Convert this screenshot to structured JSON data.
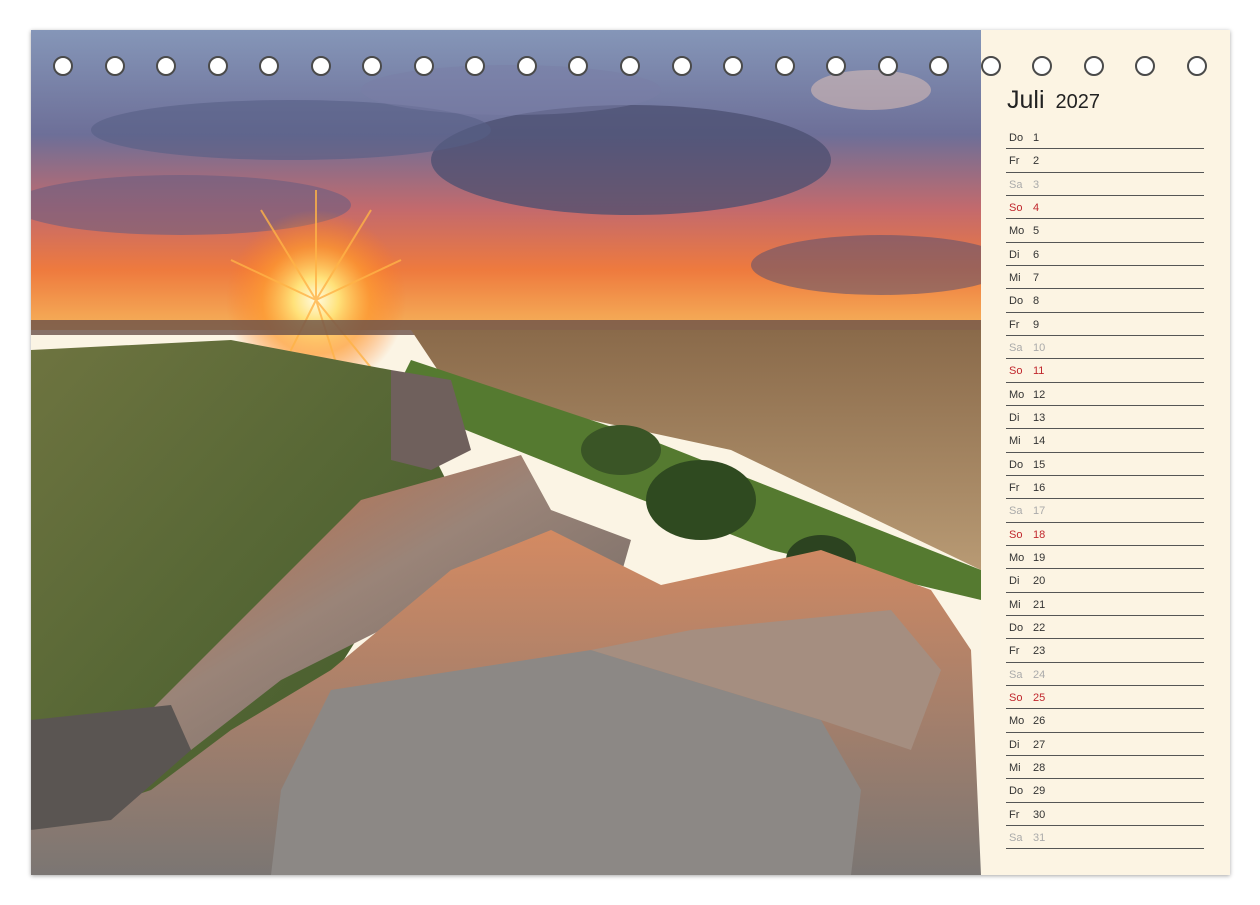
{
  "calendar": {
    "month": "Juli",
    "year": "2027",
    "days": [
      {
        "weekday": "Do",
        "day": "1",
        "type": "weekday"
      },
      {
        "weekday": "Fr",
        "day": "2",
        "type": "weekday"
      },
      {
        "weekday": "Sa",
        "day": "3",
        "type": "saturday"
      },
      {
        "weekday": "So",
        "day": "4",
        "type": "sunday"
      },
      {
        "weekday": "Mo",
        "day": "5",
        "type": "weekday"
      },
      {
        "weekday": "Di",
        "day": "6",
        "type": "weekday"
      },
      {
        "weekday": "Mi",
        "day": "7",
        "type": "weekday"
      },
      {
        "weekday": "Do",
        "day": "8",
        "type": "weekday"
      },
      {
        "weekday": "Fr",
        "day": "9",
        "type": "weekday"
      },
      {
        "weekday": "Sa",
        "day": "10",
        "type": "saturday"
      },
      {
        "weekday": "So",
        "day": "11",
        "type": "sunday"
      },
      {
        "weekday": "Mo",
        "day": "12",
        "type": "weekday"
      },
      {
        "weekday": "Di",
        "day": "13",
        "type": "weekday"
      },
      {
        "weekday": "Mi",
        "day": "14",
        "type": "weekday"
      },
      {
        "weekday": "Do",
        "day": "15",
        "type": "weekday"
      },
      {
        "weekday": "Fr",
        "day": "16",
        "type": "weekday"
      },
      {
        "weekday": "Sa",
        "day": "17",
        "type": "saturday"
      },
      {
        "weekday": "So",
        "day": "18",
        "type": "sunday"
      },
      {
        "weekday": "Mo",
        "day": "19",
        "type": "weekday"
      },
      {
        "weekday": "Di",
        "day": "20",
        "type": "weekday"
      },
      {
        "weekday": "Mi",
        "day": "21",
        "type": "weekday"
      },
      {
        "weekday": "Do",
        "day": "22",
        "type": "weekday"
      },
      {
        "weekday": "Fr",
        "day": "23",
        "type": "weekday"
      },
      {
        "weekday": "Sa",
        "day": "24",
        "type": "saturday"
      },
      {
        "weekday": "So",
        "day": "25",
        "type": "sunday"
      },
      {
        "weekday": "Mo",
        "day": "26",
        "type": "weekday"
      },
      {
        "weekday": "Di",
        "day": "27",
        "type": "weekday"
      },
      {
        "weekday": "Mi",
        "day": "28",
        "type": "weekday"
      },
      {
        "weekday": "Do",
        "day": "29",
        "type": "weekday"
      },
      {
        "weekday": "Fr",
        "day": "30",
        "type": "weekday"
      },
      {
        "weekday": "Sa",
        "day": "31",
        "type": "saturday"
      }
    ]
  },
  "binding": {
    "ring_count": 23
  },
  "colors": {
    "sunday": "#c0272d",
    "saturday": "#aaaaaa",
    "paper": "#fcf4e3"
  },
  "photo": {
    "subject": "sunset over rocky ridge landscape"
  }
}
